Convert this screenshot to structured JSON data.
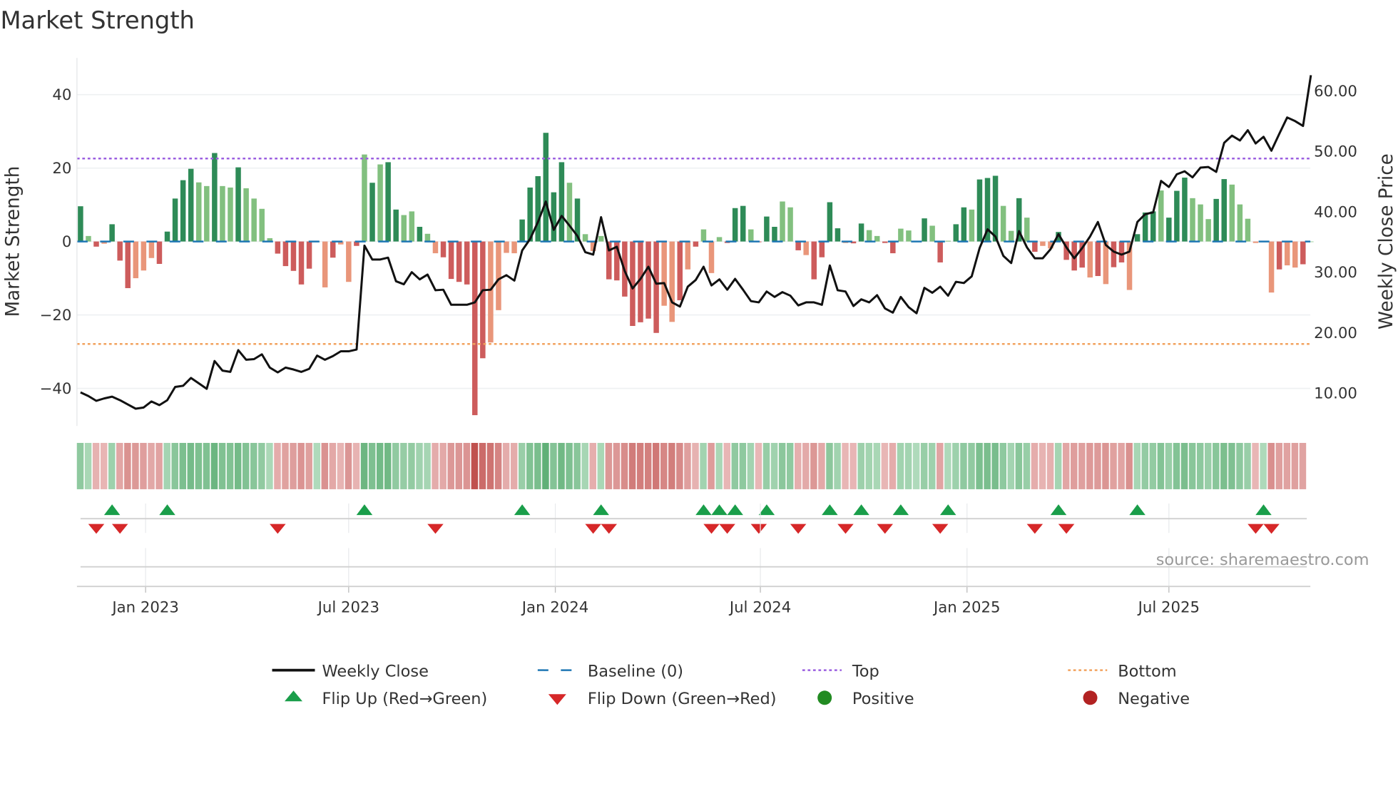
{
  "chart_data": {
    "type": "bar",
    "title": "Market Strength",
    "ylabel": "Market Strength",
    "y2label": "Weekly Close Price",
    "ylim": [
      -50,
      50
    ],
    "y2lim": [
      4.7,
      64
    ],
    "yticks": [
      "40",
      "20",
      "0",
      "−20",
      "−40"
    ],
    "ytick_values": [
      40,
      20,
      0,
      -20,
      -40
    ],
    "y2ticks": [
      "60.00",
      "50.00",
      "40.00",
      "30.00",
      "20.00",
      "10.00"
    ],
    "y2tick_values": [
      60,
      50,
      40,
      30,
      20,
      10
    ],
    "xticks": [
      {
        "label": "Jan 2023",
        "week": 8.25
      },
      {
        "label": "Jul 2023",
        "week": 34
      },
      {
        "label": "Jan 2024",
        "week": 60.2
      },
      {
        "label": "Jul 2024",
        "week": 86.2
      },
      {
        "label": "Jan 2025",
        "week": 112.4
      },
      {
        "label": "Jul 2025",
        "week": 138
      }
    ],
    "top_level": 22.6,
    "bottom_level": -27.9,
    "baseline": 0,
    "strength": [
      9.6,
      1.5,
      -1.4,
      -0.6,
      4.7,
      -5.2,
      -12.7,
      -10,
      -7.9,
      -4.5,
      -6.1,
      2.7,
      11.7,
      16.7,
      19.8,
      16.1,
      15.1,
      24.1,
      15.1,
      14.7,
      20.2,
      14.5,
      11.7,
      8.9,
      0.9,
      -3.3,
      -6.7,
      -8,
      -11.7,
      -7.4,
      0,
      -12.5,
      -4.4,
      -0.8,
      -11,
      -1.2,
      23.7,
      16,
      21,
      21.6,
      8.7,
      7.2,
      8.2,
      4,
      2.1,
      -3.2,
      -4.3,
      -10.2,
      -11,
      -11.7,
      -47.3,
      -31.8,
      -27.5,
      -18.7,
      -3.1,
      -3.2,
      6,
      14.7,
      17.8,
      29.6,
      13.4,
      21.6,
      16,
      11.7,
      2,
      -2.6,
      1.5,
      -10.3,
      -10.6,
      -15,
      -23,
      -22,
      -21,
      -24.9,
      -17.5,
      -21.9,
      -16,
      -7.6,
      -1.4,
      3.3,
      -8.6,
      1.2,
      -0.4,
      9.1,
      9.7,
      3.3,
      -0.2,
      6.8,
      4,
      10.9,
      9.3,
      -2.4,
      -3.7,
      -10.3,
      -4.3,
      10.7,
      3.6,
      -0.4,
      -0.5,
      4.9,
      3.1,
      1.5,
      -0.4,
      -3.2,
      3.5,
      3,
      0,
      6.3,
      4.3,
      -5.7,
      0.2,
      4.7,
      9.3,
      8.7,
      16.9,
      17.3,
      17.9,
      9.7,
      2.9,
      11.8,
      6.5,
      -2.8,
      -1.2,
      -1.9,
      2.6,
      -5,
      -7.9,
      -7.1,
      -9.8,
      -9.4,
      -11.6,
      -7,
      -5.7,
      -13.2,
      2,
      7.9,
      8.2,
      13.9,
      6.5,
      13.8,
      17.4,
      11.8,
      10.1,
      6.1,
      11.6,
      17,
      15.5,
      10.1,
      6.2,
      -0.4,
      0.2,
      -13.9,
      -7.6,
      -6.5,
      -7.1,
      -6.2,
      0
    ],
    "shade": "dldldddllldddddlldlldlllldddddlldlldldlddlldllddddddllllddddddldllldddddddlldldllldddldddlldlddddlddllddllddldlddldddlldldllddddldlddldddldddlllddlllldldlldll",
    "weekly_close": [
      10.1,
      9.5,
      8.7,
      9.1,
      9.4,
      8.8,
      8.1,
      7.4,
      7.6,
      8.6,
      8,
      8.8,
      11,
      11.2,
      12.5,
      11.6,
      10.7,
      15.3,
      13.7,
      13.5,
      17.1,
      15.5,
      15.6,
      16.4,
      14.2,
      13.4,
      14.2,
      13.9,
      13.5,
      14,
      16.2,
      15.5,
      16.1,
      16.9,
      16.9,
      17.2,
      34.4,
      32.1,
      32.1,
      32.4,
      28.5,
      28,
      30,
      28.8,
      29.6,
      27,
      27.1,
      24.6,
      24.6,
      24.6,
      25,
      27,
      27.1,
      28.8,
      29.5,
      28.6,
      33.6,
      35.5,
      38.3,
      41.7,
      37,
      39.3,
      37.7,
      36,
      33.3,
      32.9,
      39.1,
      33.6,
      34.2,
      30.2,
      27.3,
      28.9,
      30.9,
      28.1,
      28.2,
      25,
      24.3,
      27.6,
      28.7,
      30.9,
      27.8,
      28.8,
      27.1,
      28.9,
      27.1,
      25.2,
      25,
      26.8,
      25.9,
      26.7,
      26.1,
      24.5,
      25,
      25,
      24.6,
      31.1,
      27,
      26.8,
      24.4,
      25.5,
      25,
      26.2,
      24,
      23.3,
      25.9,
      24.2,
      23.2,
      27.4,
      26.6,
      27.6,
      26.1,
      28.4,
      28.2,
      29.3,
      34,
      37.1,
      35.9,
      32.7,
      31.5,
      36.8,
      34.1,
      32.3,
      32.3,
      33.8,
      36.3,
      34.1,
      32.3,
      34,
      35.9,
      38.3,
      34.5,
      33.4,
      32.9,
      33.4,
      38.3,
      39.6,
      39.9,
      45.1,
      44.1,
      46.2,
      46.7,
      45.7,
      47.3,
      47.4,
      46.6,
      51.4,
      52.6,
      51.8,
      53.5,
      51.3,
      52.4,
      50.1,
      52.9,
      55.6,
      55,
      54.2,
      62.6
    ],
    "flip_up_weeks": [
      4,
      11,
      36,
      56,
      66,
      79,
      81,
      83,
      87,
      95,
      99,
      104,
      110,
      124,
      134,
      150
    ],
    "flip_down_weeks": [
      2,
      5,
      25,
      45,
      65,
      67,
      80,
      82,
      86,
      91,
      97,
      102,
      109,
      121,
      125,
      149,
      151
    ],
    "legend": [
      {
        "label": "Weekly Close",
        "kind": "line"
      },
      {
        "label": "Baseline (0)",
        "kind": "dash"
      },
      {
        "label": "Top",
        "kind": "dot-top"
      },
      {
        "label": "Bottom",
        "kind": "dot-bottom"
      },
      {
        "label": "Flip Up (Red→Green)",
        "kind": "tri-up"
      },
      {
        "label": "Flip Down (Green→Red)",
        "kind": "tri-down"
      },
      {
        "label": "Positive",
        "kind": "dot-pos"
      },
      {
        "label": "Negative",
        "kind": "dot-neg"
      }
    ],
    "legend_position": "bottom-center",
    "source": "source: sharemaestro.com",
    "colors": {
      "pos_dark": "#2e8b57",
      "pos_light": "#82c07f",
      "neg_dark": "#cd5c5c",
      "neg_light": "#e9967a",
      "line": "#111111",
      "baseline": "#1f77b4",
      "top": "#9b5fe0",
      "bottom": "#f2a25e",
      "flip_up": "#1a9e4a",
      "flip_down": "#d62728",
      "positive": "#228b22",
      "negative": "#b22222"
    }
  }
}
